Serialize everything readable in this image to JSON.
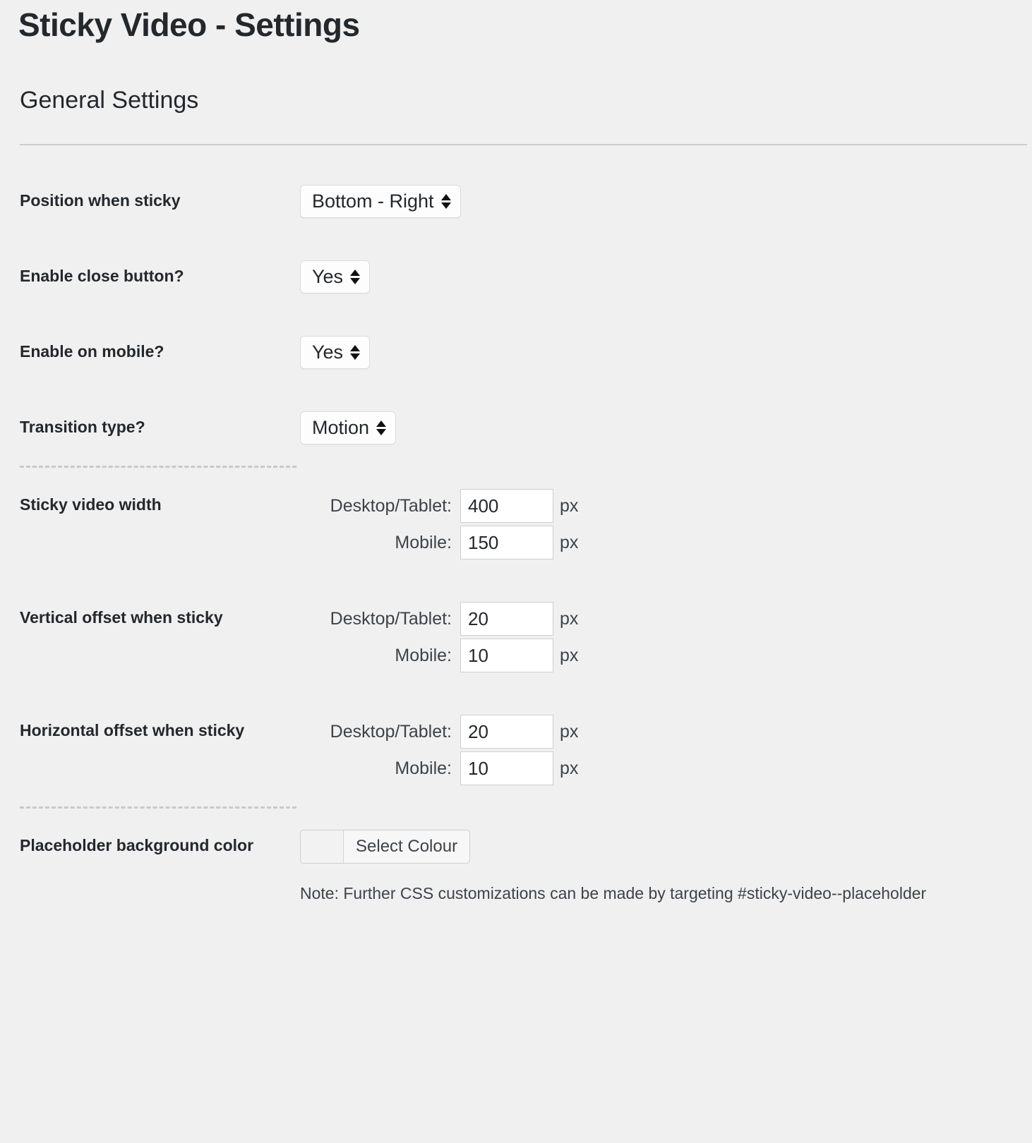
{
  "page": {
    "title": "Sticky Video - Settings",
    "section_title": "General Settings"
  },
  "settings": {
    "position": {
      "label": "Position when sticky",
      "value": "Bottom - Right"
    },
    "close_button": {
      "label": "Enable close button?",
      "value": "Yes"
    },
    "mobile": {
      "label": "Enable on mobile?",
      "value": "Yes"
    },
    "transition": {
      "label": "Transition type?",
      "value": "Motion"
    },
    "video_width": {
      "label": "Sticky video width",
      "desktop_label": "Desktop/Tablet:",
      "desktop_value": "400",
      "desktop_unit": "px",
      "mobile_label": "Mobile:",
      "mobile_value": "150",
      "mobile_unit": "px"
    },
    "vertical_offset": {
      "label": "Vertical offset when sticky",
      "desktop_label": "Desktop/Tablet:",
      "desktop_value": "20",
      "desktop_unit": "px",
      "mobile_label": "Mobile:",
      "mobile_value": "10",
      "mobile_unit": "px"
    },
    "horizontal_offset": {
      "label": "Horizontal offset when sticky",
      "desktop_label": "Desktop/Tablet:",
      "desktop_value": "20",
      "desktop_unit": "px",
      "mobile_label": "Mobile:",
      "mobile_value": "10",
      "mobile_unit": "px"
    },
    "placeholder_color": {
      "label": "Placeholder background color",
      "button_label": "Select Colour",
      "swatch_color": "#f2f2f2",
      "note": "Note: Further CSS customizations can be made by targeting #sticky-video--placeholder"
    }
  },
  "colors": {
    "page_background": "#f0f0f0",
    "text": "#23282d",
    "muted_text": "#3c434a",
    "border": "#cfcfcf",
    "rule": "#cccccc",
    "dashed": "#c9c9c9"
  }
}
